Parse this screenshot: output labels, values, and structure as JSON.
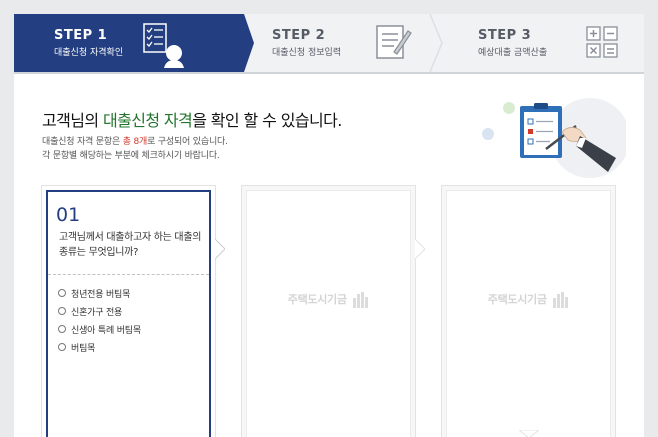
{
  "steps": [
    {
      "title": "STEP 1",
      "label": "대출신청 자격확인",
      "active": true,
      "icon": "checklist-person-icon"
    },
    {
      "title": "STEP 2",
      "label": "대출신청 정보입력",
      "active": false,
      "icon": "form-pencil-icon"
    },
    {
      "title": "STEP 3",
      "label": "예상대출 금액산출",
      "active": false,
      "icon": "calculator-icon"
    }
  ],
  "headline": {
    "part1": "고객님의 ",
    "highlight": "대출신청 자격",
    "part2": "을 확인 할 수 있습니다."
  },
  "description": {
    "line1_before": "대출신청 자격 문항은 ",
    "line1_count": "총 8개",
    "line1_after": "로 구성되어 있습니다.",
    "line2": "각 문항별 해당하는 부분에 체크하시기 바랍니다."
  },
  "question": {
    "number": "01",
    "text": "고객님께서 대출하고자 하는 대출의 종류는 무엇입니까?",
    "options": [
      "청년전용 버팀목",
      "신혼가구 전용",
      "신생아 특례 버팀목",
      "버팀목"
    ]
  },
  "placeholder_logo": "주택도시기금",
  "colors": {
    "primary": "#243f81",
    "accent_green": "#23752d",
    "accent_red": "#d23a2c"
  }
}
